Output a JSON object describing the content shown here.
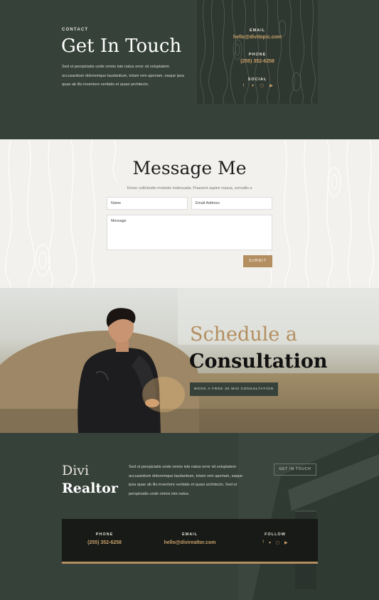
{
  "hero": {
    "eyebrow": "CONTACT",
    "title": "Get In Touch",
    "body": "Sed ut perspiciatis unde omnis iste natus error sit voluptatem accusantium doloremque laudantium, totam rem aperiam, eaque ipsa quae ab illo inventore veritatis et quasi architecto.",
    "card": {
      "email_label": "EMAIL",
      "email": "hello@divitopic.com",
      "phone_label": "PHONE",
      "phone": "(255) 352-6258",
      "social_label": "SOCIAL",
      "social_icons": [
        "facebook-icon",
        "twitter-icon",
        "instagram-icon",
        "youtube-icon"
      ]
    }
  },
  "message": {
    "title": "Message Me",
    "subtitle": "Donec sollicitudin molestie malesuada. Praesent sapien massa, convallis a",
    "name_placeholder": "Name",
    "email_placeholder": "Email Address",
    "message_placeholder": "Message",
    "submit_label": "SUBMIT"
  },
  "consult": {
    "line1": "Schedule a",
    "line2": "Consultation",
    "button": "BOOK A FREE 30 MIN CONSULTATION"
  },
  "footer": {
    "brand_line1": "Divi",
    "brand_line2": "Realtor",
    "body": "Sed ut perspiciatis unde omnis iste natus error sit voluptatem accusantium doloremque laudantium, totam rem aperiam, eaque ipsa quae ab illo inventore veritatis et quasi architecto. Sed ut perspiciatis unde omnis iste natus.",
    "cta": "GET IN TOUCH",
    "phone_label": "PHONE",
    "phone": "(255) 352-6258",
    "email_label": "EMAIL",
    "email": "hello@divirealtor.com",
    "follow_label": "FOLLOW",
    "social_icons": [
      "facebook-icon",
      "twitter-icon",
      "instagram-icon",
      "youtube-icon"
    ]
  },
  "colors": {
    "dark_green": "#36413a",
    "accent_gold": "#b38e60",
    "link_gold": "#c9a06a"
  }
}
